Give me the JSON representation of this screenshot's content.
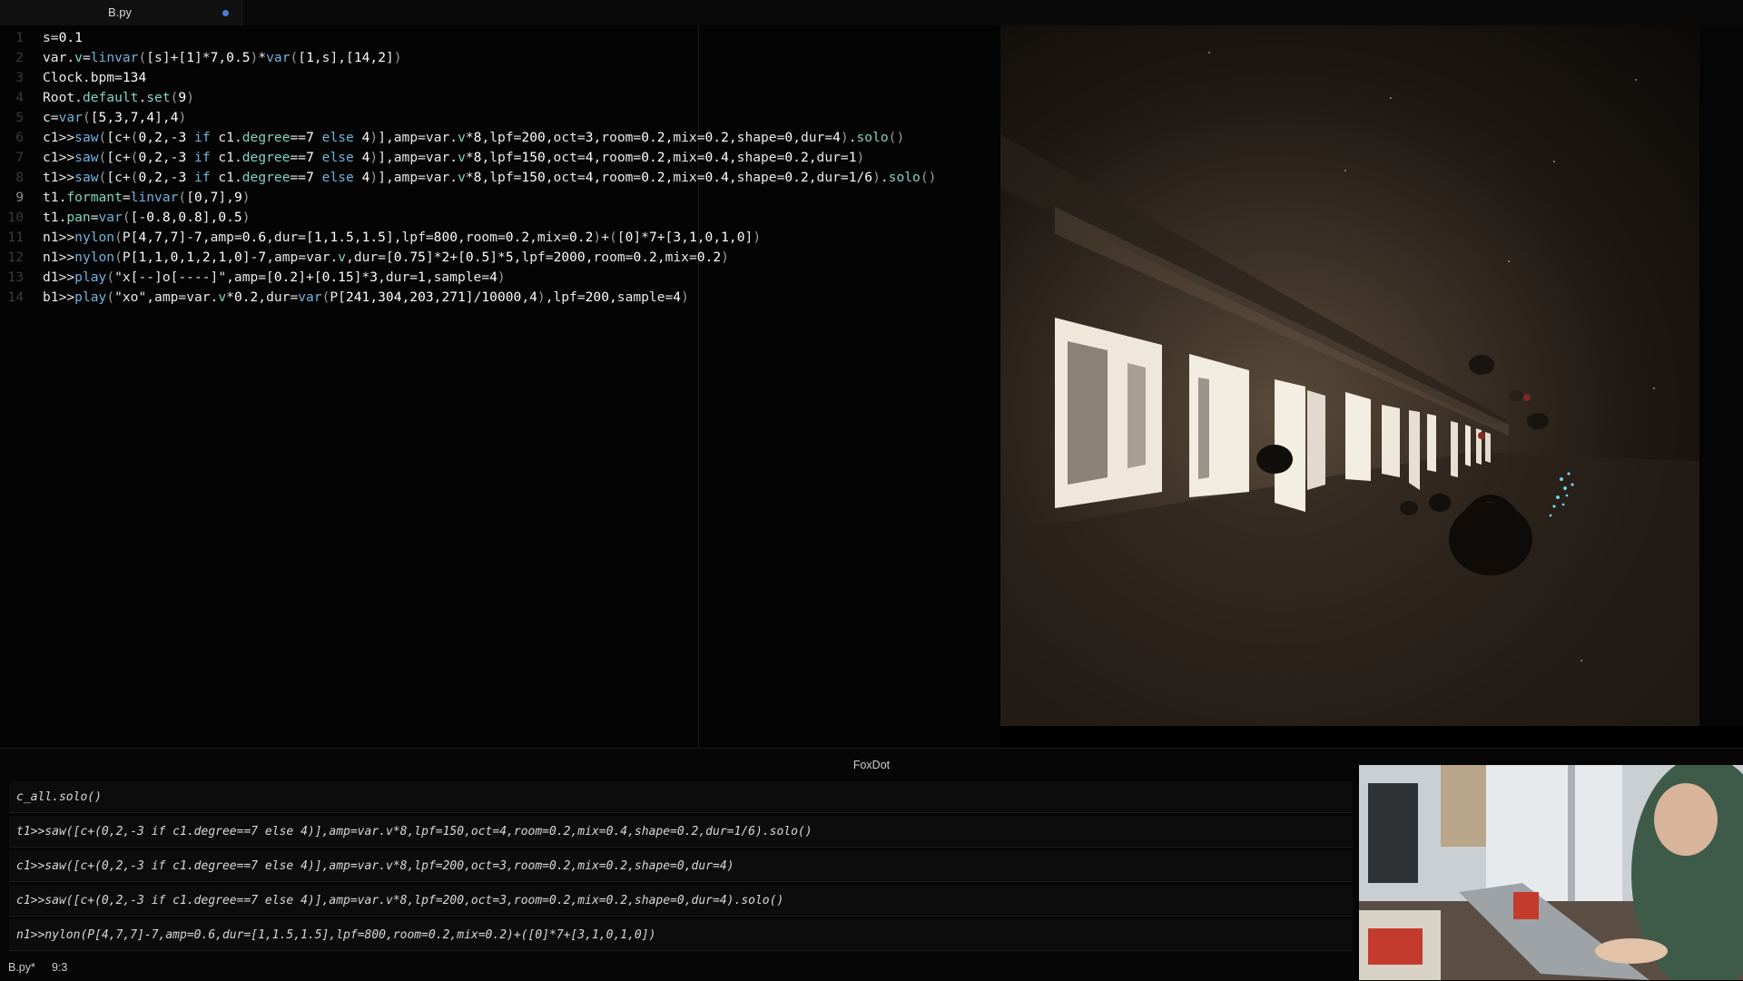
{
  "tab": {
    "name": "B.py"
  },
  "code": {
    "lines": [
      {
        "num": "1",
        "text": "s=0.1"
      },
      {
        "num": "2",
        "text": "var.v=linvar([s]+[1]*7,0.5)*var([1,s],[14,2])"
      },
      {
        "num": "3",
        "text": "Clock.bpm=134"
      },
      {
        "num": "4",
        "text": "Root.default.set(9)"
      },
      {
        "num": "5",
        "text": "c=var([5,3,7,4],4)"
      },
      {
        "num": "6",
        "text": "c1>>saw([c+(0,2,-3 if c1.degree==7 else 4)],amp=var.v*8,lpf=200,oct=3,room=0.2,mix=0.2,shape=0,dur=4).solo()"
      },
      {
        "num": "7",
        "text": "c1>>saw([c+(0,2,-3 if c1.degree==7 else 4)],amp=var.v*8,lpf=150,oct=4,room=0.2,mix=0.4,shape=0.2,dur=1)"
      },
      {
        "num": "8",
        "text": "t1>>saw([c+(0,2,-3 if c1.degree==7 else 4)],amp=var.v*8,lpf=150,oct=4,room=0.2,mix=0.4,shape=0.2,dur=1/6).solo()"
      },
      {
        "num": "9",
        "text": "t1.formant=linvar([0,7],9)"
      },
      {
        "num": "10",
        "text": "t1.pan=var([-0.8,0.8],0.5)"
      },
      {
        "num": "11",
        "text": "n1>>nylon(P[4,7,7]-7,amp=0.6,dur=[1,1.5,1.5],lpf=800,room=0.2,mix=0.2)+([0]*7+[3,1,0,1,0])"
      },
      {
        "num": "12",
        "text": "n1>>nylon(P[1,1,0,1,2,1,0]-7,amp=var.v,dur=[0.75]*2+[0.5]*5,lpf=2000,room=0.2,mix=0.2)"
      },
      {
        "num": "13",
        "text": "d1>>play(\"x[--]o[----]\",amp=[0.2]+[0.15]*3,dur=1,sample=4)"
      },
      {
        "num": "14",
        "text": "b1>>play(\"xo\",amp=var.v*0.2,dur=var(P[241,304,203,271]/10000,4),lpf=200,sample=4)"
      }
    ],
    "active_line": "9"
  },
  "console": {
    "title": "FoxDot",
    "lines": [
      "c_all.solo()",
      "t1>>saw([c+(0,2,-3 if c1.degree==7 else 4)],amp=var.v*8,lpf=150,oct=4,room=0.2,mix=0.4,shape=0.2,dur=1/6).solo()",
      "c1>>saw([c+(0,2,-3 if c1.degree==7 else 4)],amp=var.v*8,lpf=200,oct=3,room=0.2,mix=0.2,shape=0,dur=4)",
      "c1>>saw([c+(0,2,-3 if c1.degree==7 else 4)],amp=var.v*8,lpf=200,oct=3,room=0.2,mix=0.2,shape=0,dur=4).solo()",
      "n1>>nylon(P[4,7,7]-7,amp=0.6,dur=[1,1.5,1.5],lpf=800,room=0.2,mix=0.2)+([0]*7+[3,1,0,1,0])"
    ]
  },
  "status": {
    "file": "B.py*",
    "position": "9:3"
  },
  "colors": {
    "accent": "#4a7bd6",
    "function": "#6fb3e0",
    "attribute": "#7fd4c0"
  }
}
